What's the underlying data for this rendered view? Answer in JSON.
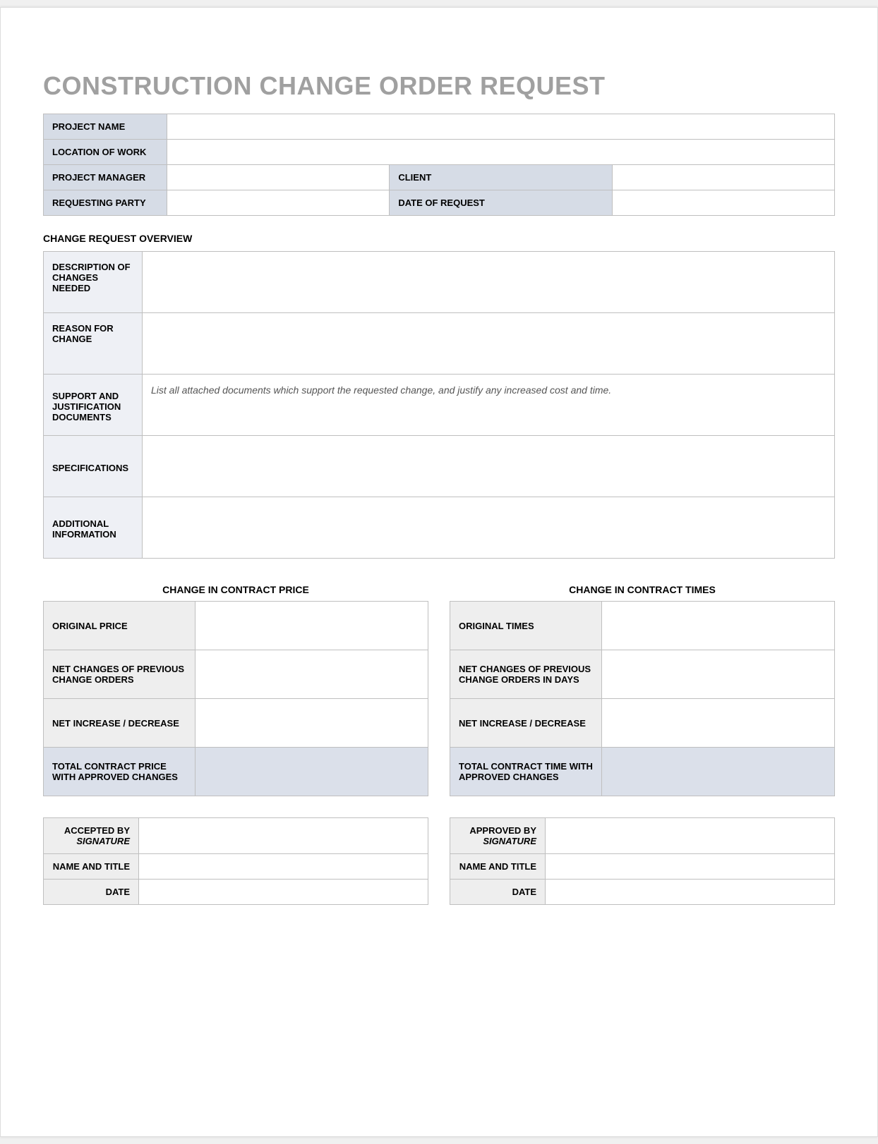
{
  "title": "CONSTRUCTION CHANGE ORDER REQUEST",
  "header": {
    "project_name_label": "PROJECT NAME",
    "project_name_value": "",
    "location_label": "LOCATION OF WORK",
    "location_value": "",
    "pm_label": "PROJECT MANAGER",
    "pm_value": "",
    "client_label": "CLIENT",
    "client_value": "",
    "requesting_party_label": "REQUESTING PARTY",
    "requesting_party_value": "",
    "date_label": "DATE OF REQUEST",
    "date_value": ""
  },
  "overview": {
    "heading": "CHANGE REQUEST OVERVIEW",
    "description_label": "DESCRIPTION OF CHANGES NEEDED",
    "description_value": "",
    "reason_label": "REASON FOR CHANGE",
    "reason_value": "",
    "support_label": "SUPPORT AND JUSTIFICATION DOCUMENTS",
    "support_hint": "List all attached documents which support the requested change, and justify any increased cost and time.",
    "specifications_label": "SPECIFICATIONS",
    "specifications_value": "",
    "additional_label": "ADDITIONAL INFORMATION",
    "additional_value": ""
  },
  "price": {
    "heading": "CHANGE IN CONTRACT PRICE",
    "original_label": "ORIGINAL PRICE",
    "original_value": "",
    "net_changes_label": "NET CHANGES OF PREVIOUS CHANGE ORDERS",
    "net_changes_value": "",
    "net_inc_label": "NET INCREASE / DECREASE",
    "net_inc_value": "",
    "total_label": "TOTAL CONTRACT PRICE WITH APPROVED CHANGES",
    "total_value": ""
  },
  "times": {
    "heading": "CHANGE IN CONTRACT TIMES",
    "original_label": "ORIGINAL TIMES",
    "original_value": "",
    "net_changes_label": "NET CHANGES OF PREVIOUS CHANGE ORDERS IN DAYS",
    "net_changes_value": "",
    "net_inc_label": "NET INCREASE / DECREASE",
    "net_inc_value": "",
    "total_label": "TOTAL CONTRACT TIME WITH APPROVED CHANGES",
    "total_value": ""
  },
  "accepted": {
    "sig_label": "ACCEPTED BY",
    "sig_sub": "SIGNATURE",
    "sig_value": "",
    "name_label": "NAME AND TITLE",
    "name_value": "",
    "date_label": "DATE",
    "date_value": ""
  },
  "approved": {
    "sig_label": "APPROVED BY",
    "sig_sub": "SIGNATURE",
    "sig_value": "",
    "name_label": "NAME AND TITLE",
    "name_value": "",
    "date_label": "DATE",
    "date_value": ""
  }
}
